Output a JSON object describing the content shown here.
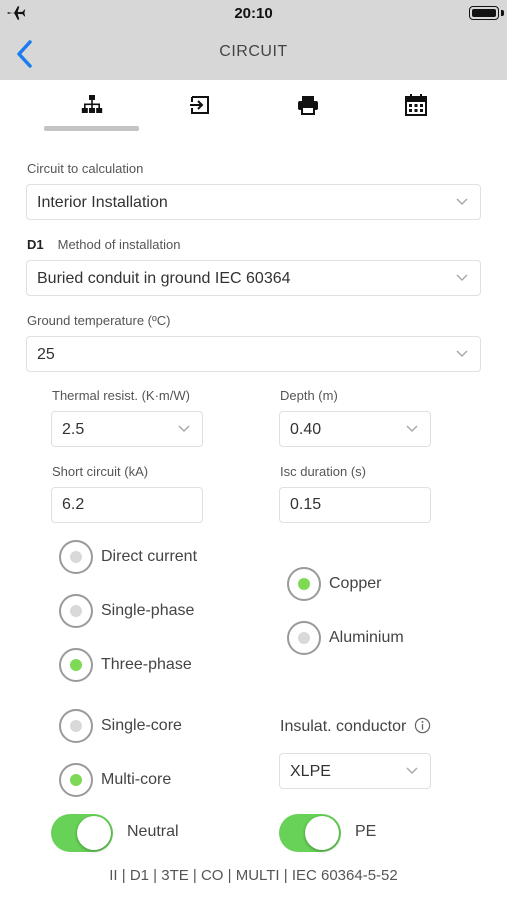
{
  "status_bar": {
    "time": "20:10",
    "airplane_icon": "airplane-icon",
    "battery_icon": "battery-icon",
    "battery_level": 1.0
  },
  "nav": {
    "title": "CIRCUIT",
    "back_icon": "chevron-left-icon"
  },
  "tabs": [
    {
      "icon": "hierarchy-icon",
      "selected": true
    },
    {
      "icon": "export-icon",
      "selected": false
    },
    {
      "icon": "printer-icon",
      "selected": false
    },
    {
      "icon": "calendar-icon",
      "selected": false
    }
  ],
  "form": {
    "circuit_label": "Circuit to calculation",
    "circuit_value": "Interior Installation",
    "method_code": "D1",
    "method_label": "Method of installation",
    "method_value": "Buried conduit in ground IEC 60364",
    "ground_temp_label": "Ground temperature (ºC)",
    "ground_temp_value": "25",
    "thermal_label": "Thermal resist. (K·m/W)",
    "thermal_value": "2.5",
    "depth_label": "Depth (m)",
    "depth_value": "0.40",
    "short_circuit_label": "Short circuit (kA)",
    "short_circuit_value": "6.2",
    "isc_label": "Isc duration (s)",
    "isc_value": "0.15",
    "insulation_label": "Insulat. conductor",
    "insulation_value": "XLPE"
  },
  "radios": {
    "current": [
      {
        "label": "Direct current",
        "checked": false
      },
      {
        "label": "Single-phase",
        "checked": false
      },
      {
        "label": "Three-phase",
        "checked": true
      }
    ],
    "material": [
      {
        "label": "Copper",
        "checked": true
      },
      {
        "label": "Aluminium",
        "checked": false
      }
    ],
    "core": [
      {
        "label": "Single-core",
        "checked": false
      },
      {
        "label": "Multi-core",
        "checked": true
      }
    ]
  },
  "toggles": {
    "neutral": {
      "label": "Neutral",
      "on": true
    },
    "pe": {
      "label": "PE",
      "on": true
    }
  },
  "summary": "II | D1 | 3TE | CO | MULTI | IEC 60364-5-52",
  "colors": {
    "accent": "#1a7cf0",
    "radio_on": "#7ed957",
    "toggle_on": "#67d257",
    "bar_bg": "#d7d7d7"
  }
}
